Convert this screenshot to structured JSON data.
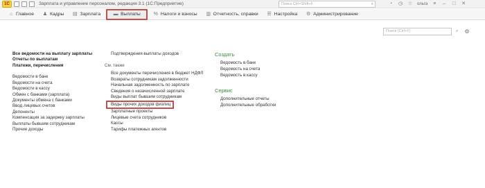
{
  "titlebar": {
    "logo": "1С",
    "title": "Зарплата и управление персоналом, редакция 3.1  (1С:Предприятие)",
    "search_placeholder": "Поиск Ctrl+Shift+F",
    "user": "ольга"
  },
  "menubar": {
    "items": [
      {
        "label": "Главное",
        "icon": "home-icon"
      },
      {
        "label": "Кадры",
        "icon": "people-icon"
      },
      {
        "label": "Зарплата",
        "icon": "document-icon"
      },
      {
        "label": "Выплаты",
        "icon": "cash-icon"
      },
      {
        "label": "Налоги и взносы",
        "icon": "percent-icon"
      },
      {
        "label": "Отчетность, справки",
        "icon": "report-icon"
      },
      {
        "label": "Настройка",
        "icon": "settings-icon"
      },
      {
        "label": "Администрирование",
        "icon": "gear-icon"
      }
    ],
    "active_index": 3,
    "highlight_color": "#c0504d"
  },
  "content_search": {
    "placeholder": "Поиск (Ctrl+F)"
  },
  "col1": {
    "bold_links": [
      "Все ведомости на выплату зарплаты",
      "Отчеты по выплатам",
      "Платежи, перечисления"
    ],
    "links": [
      "Ведомости в банк",
      "Ведомости на счета",
      "Ведомости в кассу",
      "Обмен с банками (зарплата)",
      "Документы обмена с банками",
      "Ввод лицевых счетов",
      "Депоненты",
      "Компенсация за задержку зарплаты",
      "Выплаты бывшим сотрудникам",
      "Прочие доходы"
    ]
  },
  "col2": {
    "top_link": "Подтверждения выплаты доходов",
    "see_also": "См. также",
    "links": [
      "Все документы перечисления в бюджет НДФЛ",
      "Возвраты сотрудникам задолженности",
      "Начальная задолженность по зарплате",
      "Сведения о незачисленной зарплате",
      "Виды выплат бывшим сотрудникам",
      "Виды прочих доходов физлиц",
      "Зарплатные проекты",
      "Лицевые счета сотрудников",
      "Кассы",
      "Тарифы платежных агентов"
    ],
    "highlight_index": 5
  },
  "col3": {
    "create_heading": "Создать",
    "create_links": [
      "Ведомость в банк",
      "Ведомость на счета",
      "Ведомость в кассу"
    ],
    "service_heading": "Сервис",
    "service_links": [
      "Дополнительные отчеты",
      "Дополнительные обработки"
    ],
    "heading_color": "#3b8a3b"
  }
}
